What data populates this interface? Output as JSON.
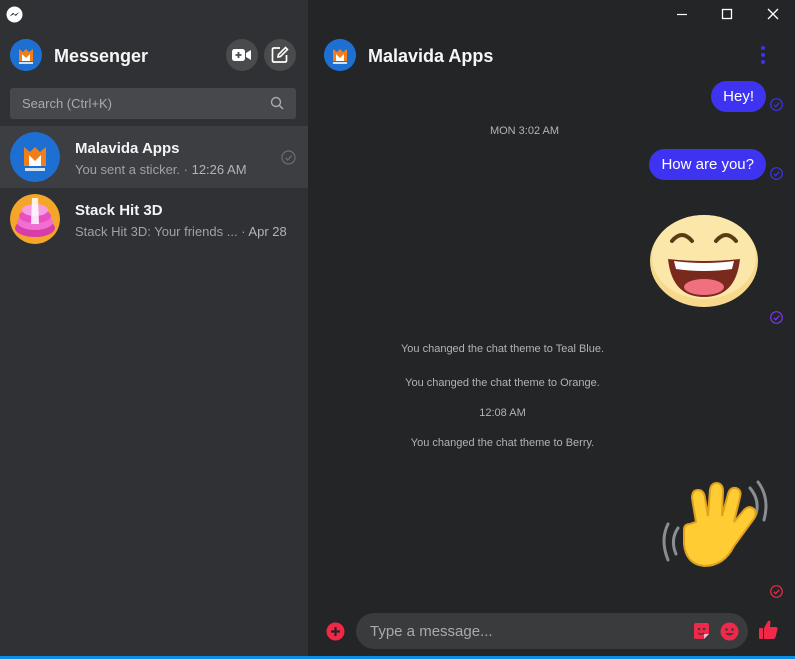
{
  "sidebar": {
    "title": "Messenger",
    "search_placeholder": "Search (Ctrl+K)",
    "conversations": [
      {
        "name": "Malavida Apps",
        "preview": "You sent a sticker.",
        "time": "12:26 AM"
      },
      {
        "name": "Stack Hit 3D",
        "preview": "Stack Hit 3D: Your friends ...",
        "time": "Apr 28"
      }
    ]
  },
  "chat": {
    "title": "Malavida Apps",
    "messages": [
      {
        "type": "outgoing",
        "text": "Hey!"
      },
      {
        "type": "timestamp",
        "text": "MON 3:02 AM"
      },
      {
        "type": "outgoing",
        "text": "How are you?"
      },
      {
        "type": "sticker",
        "name": "laughing-face-sticker"
      },
      {
        "type": "system",
        "text": "You changed the chat theme to Teal Blue."
      },
      {
        "type": "system",
        "text": "You changed the chat theme to Orange."
      },
      {
        "type": "timestamp",
        "text": "12:08 AM"
      },
      {
        "type": "system",
        "text": "You changed the chat theme to Berry."
      },
      {
        "type": "sticker",
        "name": "waving-hand-sticker"
      }
    ],
    "composer_placeholder": "Type a message..."
  },
  "colors": {
    "accent": "#3d33f0",
    "composer_icons": "#f02849",
    "window_bar": "#0c8de2"
  },
  "icons": [
    "messenger-app-icon",
    "video-call-icon",
    "compose-icon",
    "search-icon",
    "read-check-icon",
    "minimize-icon",
    "maximize-icon",
    "close-icon",
    "more-options-icon",
    "add-icon",
    "sticker-icon",
    "emoji-icon",
    "thumbs-up-icon"
  ]
}
